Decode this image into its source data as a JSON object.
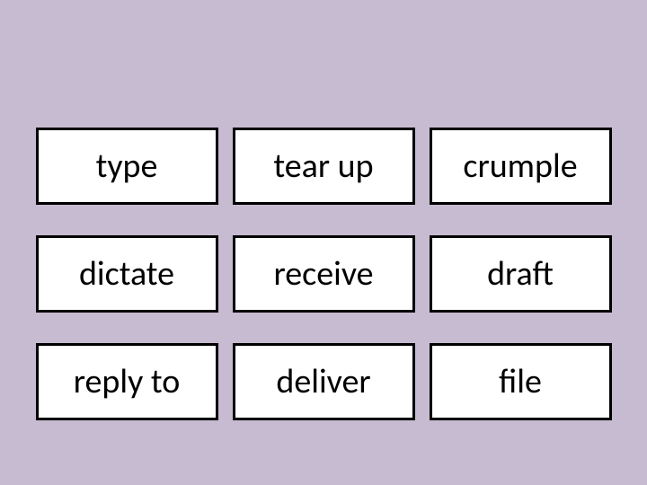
{
  "grid": {
    "cells": [
      "type",
      "tear up",
      "crumple",
      "dictate",
      "receive",
      "draft",
      "reply to",
      "deliver",
      "file"
    ]
  }
}
